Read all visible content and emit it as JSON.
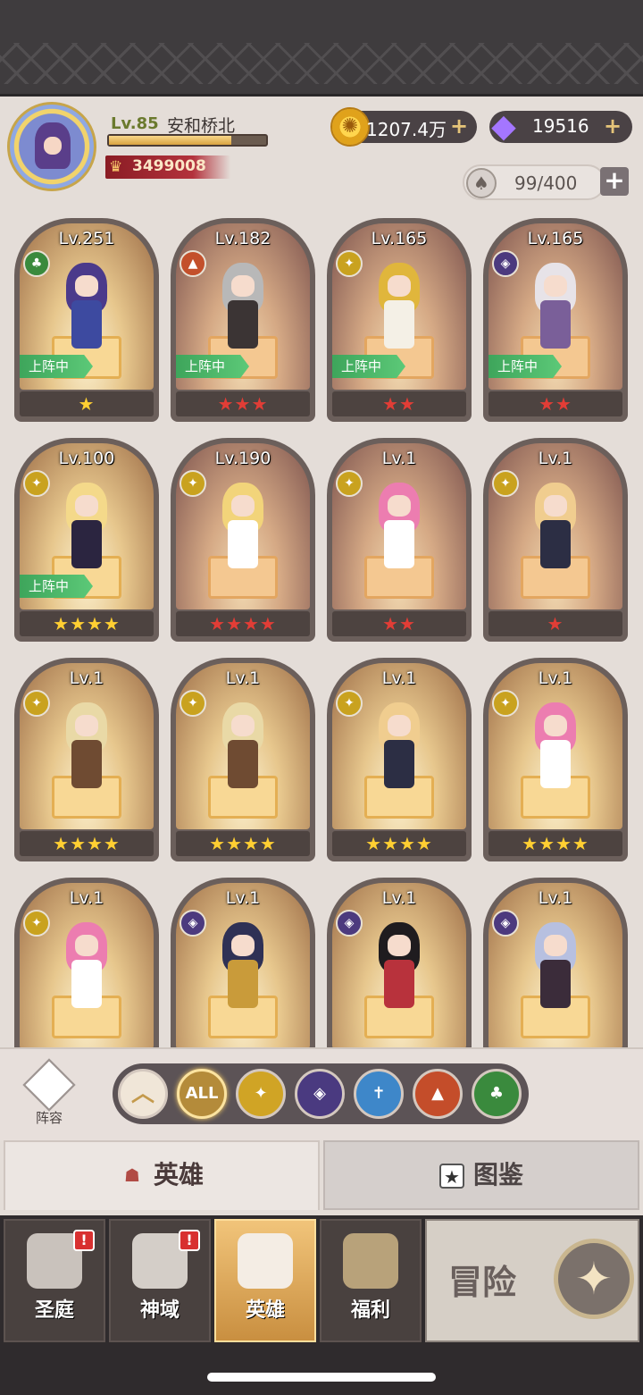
{
  "player": {
    "level": "Lv.85",
    "name": "安和桥北",
    "exp_fraction": 0.78,
    "power": "3499008"
  },
  "resources": {
    "gold": "1207.4万",
    "gems": "19516",
    "hero_capacity": "99/400",
    "plus": "+"
  },
  "heroes": [
    {
      "level": "Lv.251",
      "faction": "tree",
      "deployed": true,
      "stars": "★",
      "star_color": "gold",
      "hair": "#4b3a8b",
      "body": "#3d4aa0",
      "bg": "gold"
    },
    {
      "level": "Lv.182",
      "faction": "fox",
      "deployed": true,
      "stars": "★★★",
      "star_color": "red",
      "hair": "#b8b8b8",
      "body": "#3b3434",
      "bg": "normal"
    },
    {
      "level": "Lv.165",
      "faction": "light",
      "deployed": true,
      "stars": "★★",
      "star_color": "red",
      "hair": "#e0b63c",
      "body": "#f4f0e6",
      "bg": "normal"
    },
    {
      "level": "Lv.165",
      "faction": "dark",
      "deployed": true,
      "stars": "★★",
      "star_color": "red",
      "hair": "#e7e3e8",
      "body": "#7a5f99",
      "bg": "normal"
    },
    {
      "level": "Lv.100",
      "faction": "light",
      "deployed": true,
      "stars": "★★★★",
      "star_color": "gold",
      "hair": "#f4d98a",
      "body": "#2b2540",
      "bg": "gold"
    },
    {
      "level": "Lv.190",
      "faction": "light",
      "deployed": false,
      "stars": "★★★★",
      "star_color": "red",
      "hair": "#f2d47a",
      "body": "#ffffff",
      "bg": "normal"
    },
    {
      "level": "Lv.1",
      "faction": "light",
      "deployed": false,
      "stars": "★★",
      "star_color": "red",
      "hair": "#ec7db0",
      "body": "#ffffff",
      "bg": "normal"
    },
    {
      "level": "Lv.1",
      "faction": "light",
      "deployed": false,
      "stars": "★",
      "star_color": "red",
      "hair": "#f0cd8f",
      "body": "#2c2e44",
      "bg": "normal"
    },
    {
      "level": "Lv.1",
      "faction": "light",
      "deployed": false,
      "stars": "★★★★",
      "star_color": "gold",
      "hair": "#e9d9a6",
      "body": "#6f4b32",
      "bg": "gold"
    },
    {
      "level": "Lv.1",
      "faction": "light",
      "deployed": false,
      "stars": "★★★★",
      "star_color": "gold",
      "hair": "#e9d9a6",
      "body": "#6f4b32",
      "bg": "gold"
    },
    {
      "level": "Lv.1",
      "faction": "light",
      "deployed": false,
      "stars": "★★★★",
      "star_color": "gold",
      "hair": "#f0cd8f",
      "body": "#2c2e44",
      "bg": "gold"
    },
    {
      "level": "Lv.1",
      "faction": "light",
      "deployed": false,
      "stars": "★★★★",
      "star_color": "gold",
      "hair": "#ec7db0",
      "body": "#ffffff",
      "bg": "gold"
    },
    {
      "level": "Lv.1",
      "faction": "light",
      "deployed": false,
      "stars": "",
      "star_color": "gold",
      "hair": "#ec7db0",
      "body": "#ffffff",
      "bg": "gold"
    },
    {
      "level": "Lv.1",
      "faction": "dark",
      "deployed": false,
      "stars": "",
      "star_color": "gold",
      "hair": "#2f3155",
      "body": "#c99b3a",
      "bg": "gold"
    },
    {
      "level": "Lv.1",
      "faction": "dark",
      "deployed": false,
      "stars": "",
      "star_color": "gold",
      "hair": "#1f1c1f",
      "body": "#b8323c",
      "bg": "gold"
    },
    {
      "level": "Lv.1",
      "faction": "dark",
      "deployed": false,
      "stars": "",
      "star_color": "gold",
      "hair": "#b7c0e0",
      "body": "#3b2c3a",
      "bg": "gold"
    }
  ],
  "deployed_label": "上阵中",
  "lineup_label": "阵容",
  "filters": [
    {
      "name": "up",
      "label": "︿",
      "color": "#f0e6d8"
    },
    {
      "name": "all",
      "label": "ALL",
      "color": "#b48b3a"
    },
    {
      "name": "light",
      "label": "✦",
      "color": "#d0a425"
    },
    {
      "name": "dark",
      "label": "◈",
      "color": "#4a3a80"
    },
    {
      "name": "holy",
      "label": "✝",
      "color": "#3e87c9"
    },
    {
      "name": "beast",
      "label": "▲",
      "color": "#c44d2a"
    },
    {
      "name": "nature",
      "label": "♣",
      "color": "#3a8a3d"
    }
  ],
  "tabs": {
    "heroes": "英雄",
    "collection": "图鉴"
  },
  "nav": [
    {
      "label": "圣庭",
      "alert": true
    },
    {
      "label": "神域",
      "alert": true
    },
    {
      "label": "英雄",
      "alert": false,
      "active": true
    },
    {
      "label": "福利",
      "alert": false
    }
  ],
  "adventure": {
    "label": "冒险"
  },
  "badge_mark": "!"
}
